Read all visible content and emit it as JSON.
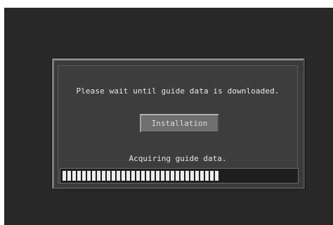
{
  "dialog": {
    "message": "Please wait until guide data is downloaded.",
    "button_label": "Installation",
    "status_text": "Acquiring guide data.",
    "progress_fraction": 0.68
  },
  "colors": {
    "screen_background": "#282828",
    "dialog_background": "#3a3a3a",
    "button_face": "#6f6f6f",
    "progress_segment": "#ececec",
    "text": "#e6e6e6"
  }
}
